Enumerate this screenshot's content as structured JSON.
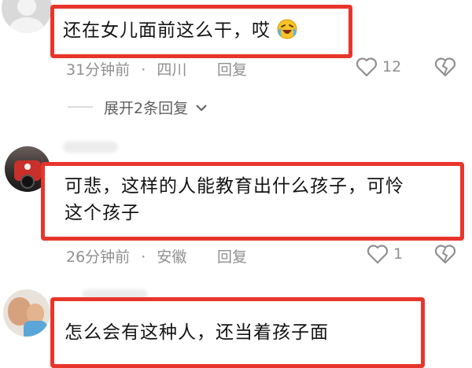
{
  "comments": [
    {
      "text": "还在女儿面前这么干，哎",
      "emoji_icon": "laughing-crying-emoji",
      "time": "31分钟前",
      "separator": "·",
      "location": "四川",
      "reply_label": "回复",
      "likes": "12"
    },
    {
      "text_line1": "可悲，这样的人能教育出什么孩子，可怜",
      "text_line2": "这个孩子",
      "time": "26分钟前",
      "separator": "·",
      "location": "安徽",
      "reply_label": "回复",
      "likes": "1"
    },
    {
      "text": "怎么会有这种人，还当着孩子面"
    }
  ],
  "expand_replies": "展开2条回复",
  "colors": {
    "highlight": "#e8352c",
    "meta": "#8f8f8f",
    "text": "#141414"
  }
}
